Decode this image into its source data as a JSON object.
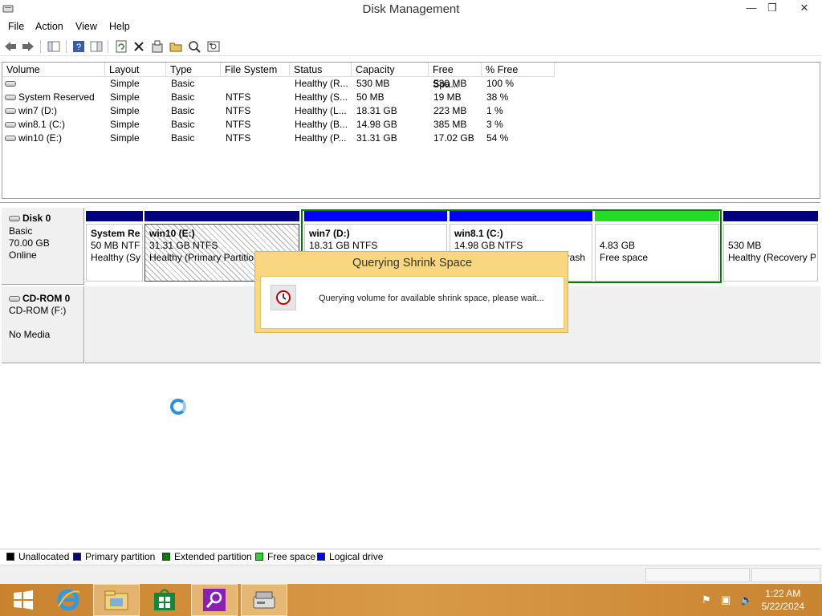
{
  "window": {
    "title": "Disk Management",
    "minimize": "—",
    "restore": "❐",
    "close": "✕"
  },
  "menu": [
    "File",
    "Action",
    "View",
    "Help"
  ],
  "volume_list": {
    "columns": [
      "Volume",
      "Layout",
      "Type",
      "File System",
      "Status",
      "Capacity",
      "Free Spa...",
      "% Free"
    ],
    "rows": [
      {
        "volume": "",
        "layout": "Simple",
        "type": "Basic",
        "fs": "",
        "status": "Healthy (R...",
        "capacity": "530 MB",
        "free": "530 MB",
        "pct": "100 %"
      },
      {
        "volume": "System Reserved",
        "layout": "Simple",
        "type": "Basic",
        "fs": "NTFS",
        "status": "Healthy (S...",
        "capacity": "50 MB",
        "free": "19 MB",
        "pct": "38 %"
      },
      {
        "volume": "win7 (D:)",
        "layout": "Simple",
        "type": "Basic",
        "fs": "NTFS",
        "status": "Healthy (L...",
        "capacity": "18.31 GB",
        "free": "223 MB",
        "pct": "1 %"
      },
      {
        "volume": "win8.1 (C:)",
        "layout": "Simple",
        "type": "Basic",
        "fs": "NTFS",
        "status": "Healthy (B...",
        "capacity": "14.98 GB",
        "free": "385 MB",
        "pct": "3 %"
      },
      {
        "volume": "win10 (E:)",
        "layout": "Simple",
        "type": "Basic",
        "fs": "NTFS",
        "status": "Healthy (P...",
        "capacity": "31.31 GB",
        "free": "17.02 GB",
        "pct": "54 %"
      }
    ]
  },
  "disk0": {
    "name": "Disk 0",
    "type": "Basic",
    "size": "70.00 GB",
    "state": "Online",
    "partitions": [
      {
        "name": "System Re",
        "size": "50 MB NTF",
        "status": "Healthy (Sy",
        "color": "#000080"
      },
      {
        "name": "win10  (E:)",
        "size": "31.31 GB NTFS",
        "status": "Healthy (Primary Partitio",
        "color": "#000080"
      },
      {
        "name": "win7  (D:)",
        "size": "18.31 GB NTFS",
        "status": "",
        "color": "#0000ff"
      },
      {
        "name": "win8.1  (C:)",
        "size": "14.98 GB NTFS",
        "status": "rash",
        "color": "#0000ff"
      },
      {
        "name": "",
        "size": "4.83 GB",
        "status": "Free space",
        "color": "#22dd22"
      },
      {
        "name": "",
        "size": "530 MB",
        "status": "Healthy (Recovery P",
        "color": "#000080"
      }
    ]
  },
  "cdrom0": {
    "name": "CD-ROM 0",
    "drive": "CD-ROM (F:)",
    "media": "No Media"
  },
  "legend": [
    {
      "label": "Unallocated",
      "color": "#000000"
    },
    {
      "label": "Primary partition",
      "color": "#000080"
    },
    {
      "label": "Extended partition",
      "color": "#008000"
    },
    {
      "label": "Free space",
      "color": "#22dd22"
    },
    {
      "label": "Logical drive",
      "color": "#0000ff"
    }
  ],
  "dialog": {
    "title": "Querying Shrink Space",
    "message": "Querying volume for available shrink space, please wait..."
  },
  "taskbar": {
    "time": "1:22 AM",
    "date": "5/22/2024"
  },
  "colors": {
    "taskbar": "#d08c38",
    "dialog_frame": "#f9d77e",
    "primary": "#000080",
    "logical": "#0000ff",
    "free": "#22dd22",
    "extended_border": "#008000"
  }
}
